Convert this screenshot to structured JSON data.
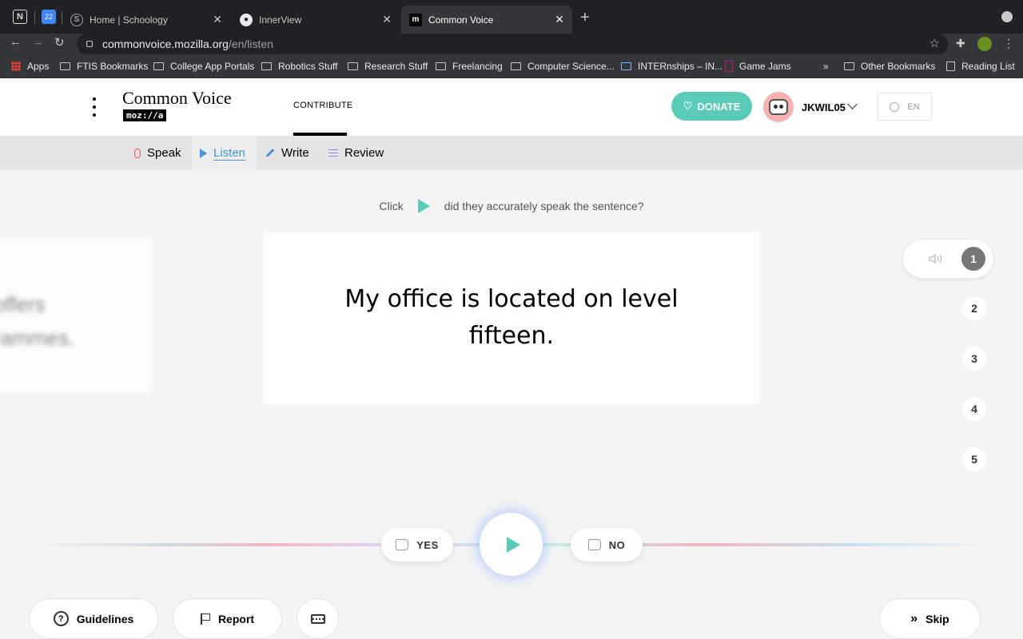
{
  "browser": {
    "tabs": [
      {
        "title": "Home | Schoology",
        "close": "✕"
      },
      {
        "title": "InnerView",
        "close": "✕"
      },
      {
        "title": "Common Voice",
        "close": "✕"
      }
    ],
    "pinned_tab_label": "22",
    "new_tab": "+",
    "url_host": "commonvoice.mozilla.org",
    "url_path": "/en/listen",
    "bookmarks": [
      "Apps",
      "FTIS Bookmarks",
      "College App Portals",
      "Robotics Stuff",
      "Research Stuff",
      "Freelancing",
      "Computer Science...",
      "INTERnships – IN...",
      "Game Jams"
    ],
    "bookmarks_overflow": "»",
    "other_bookmarks": "Other Bookmarks",
    "reading_list": "Reading List"
  },
  "header": {
    "logo_title": "Common Voice",
    "logo_sub": "moz://a",
    "nav_contribute": "CONTRIBUTE",
    "donate": "DONATE",
    "username": "JKWIL05",
    "language": "EN"
  },
  "subnav": {
    "speak": "Speak",
    "listen": "Listen",
    "write": "Write",
    "review": "Review"
  },
  "instruction": {
    "before": "Click",
    "after": "did they accurately speak the sentence?"
  },
  "previous_card_text": "offers\nrammes.",
  "sentence": "My office is located on level fifteen.",
  "clips": [
    "1",
    "2",
    "3",
    "4",
    "5"
  ],
  "actions": {
    "yes": "YES",
    "no": "NO"
  },
  "footer": {
    "guidelines": "Guidelines",
    "report": "Report",
    "skip": "Skip"
  },
  "colors": {
    "accent": "#59cbb7",
    "listen_blue": "#4a90e2",
    "mic_red": "#ff4f5e"
  }
}
